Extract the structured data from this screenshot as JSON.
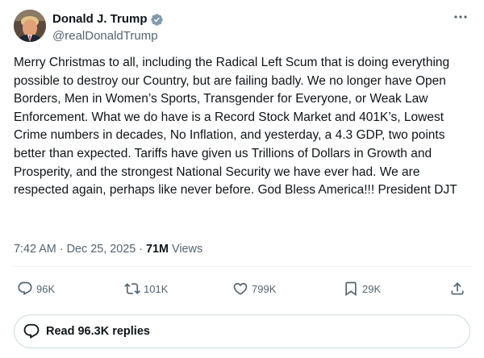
{
  "author": {
    "display_name": "Donald J. Trump",
    "handle": "@realDonaldTrump",
    "verified_color": "#829aab"
  },
  "post": {
    "text": "Merry Christmas to all, including the Radical Left Scum that is doing everything possible to destroy our Country, but are failing badly. We no longer have Open Borders, Men in Women’s Sports, Transgender for Everyone, or Weak Law Enforcement. What we do have is a Record Stock Market and 401K’s, Lowest Crime numbers in decades, No Inflation, and yesterday, a 4.3 GDP, two points better than expected. Tariffs have given us Trillions of Dollars in Growth and Prosperity, and the strongest National Security we have ever had. We are respected again, perhaps like never before. God Bless America!!! President DJT",
    "time": "7:42 AM",
    "separator": "·",
    "date": "Dec 25, 2025",
    "views_count": "71M",
    "views_label": "Views"
  },
  "actions": {
    "replies": "96K",
    "reposts": "101K",
    "likes": "799K",
    "bookmarks": "29K"
  },
  "replies_button": {
    "label": "Read 96.3K replies"
  },
  "colors": {
    "text": "#0f1419",
    "secondary": "#536471",
    "border": "#cfd9de"
  }
}
